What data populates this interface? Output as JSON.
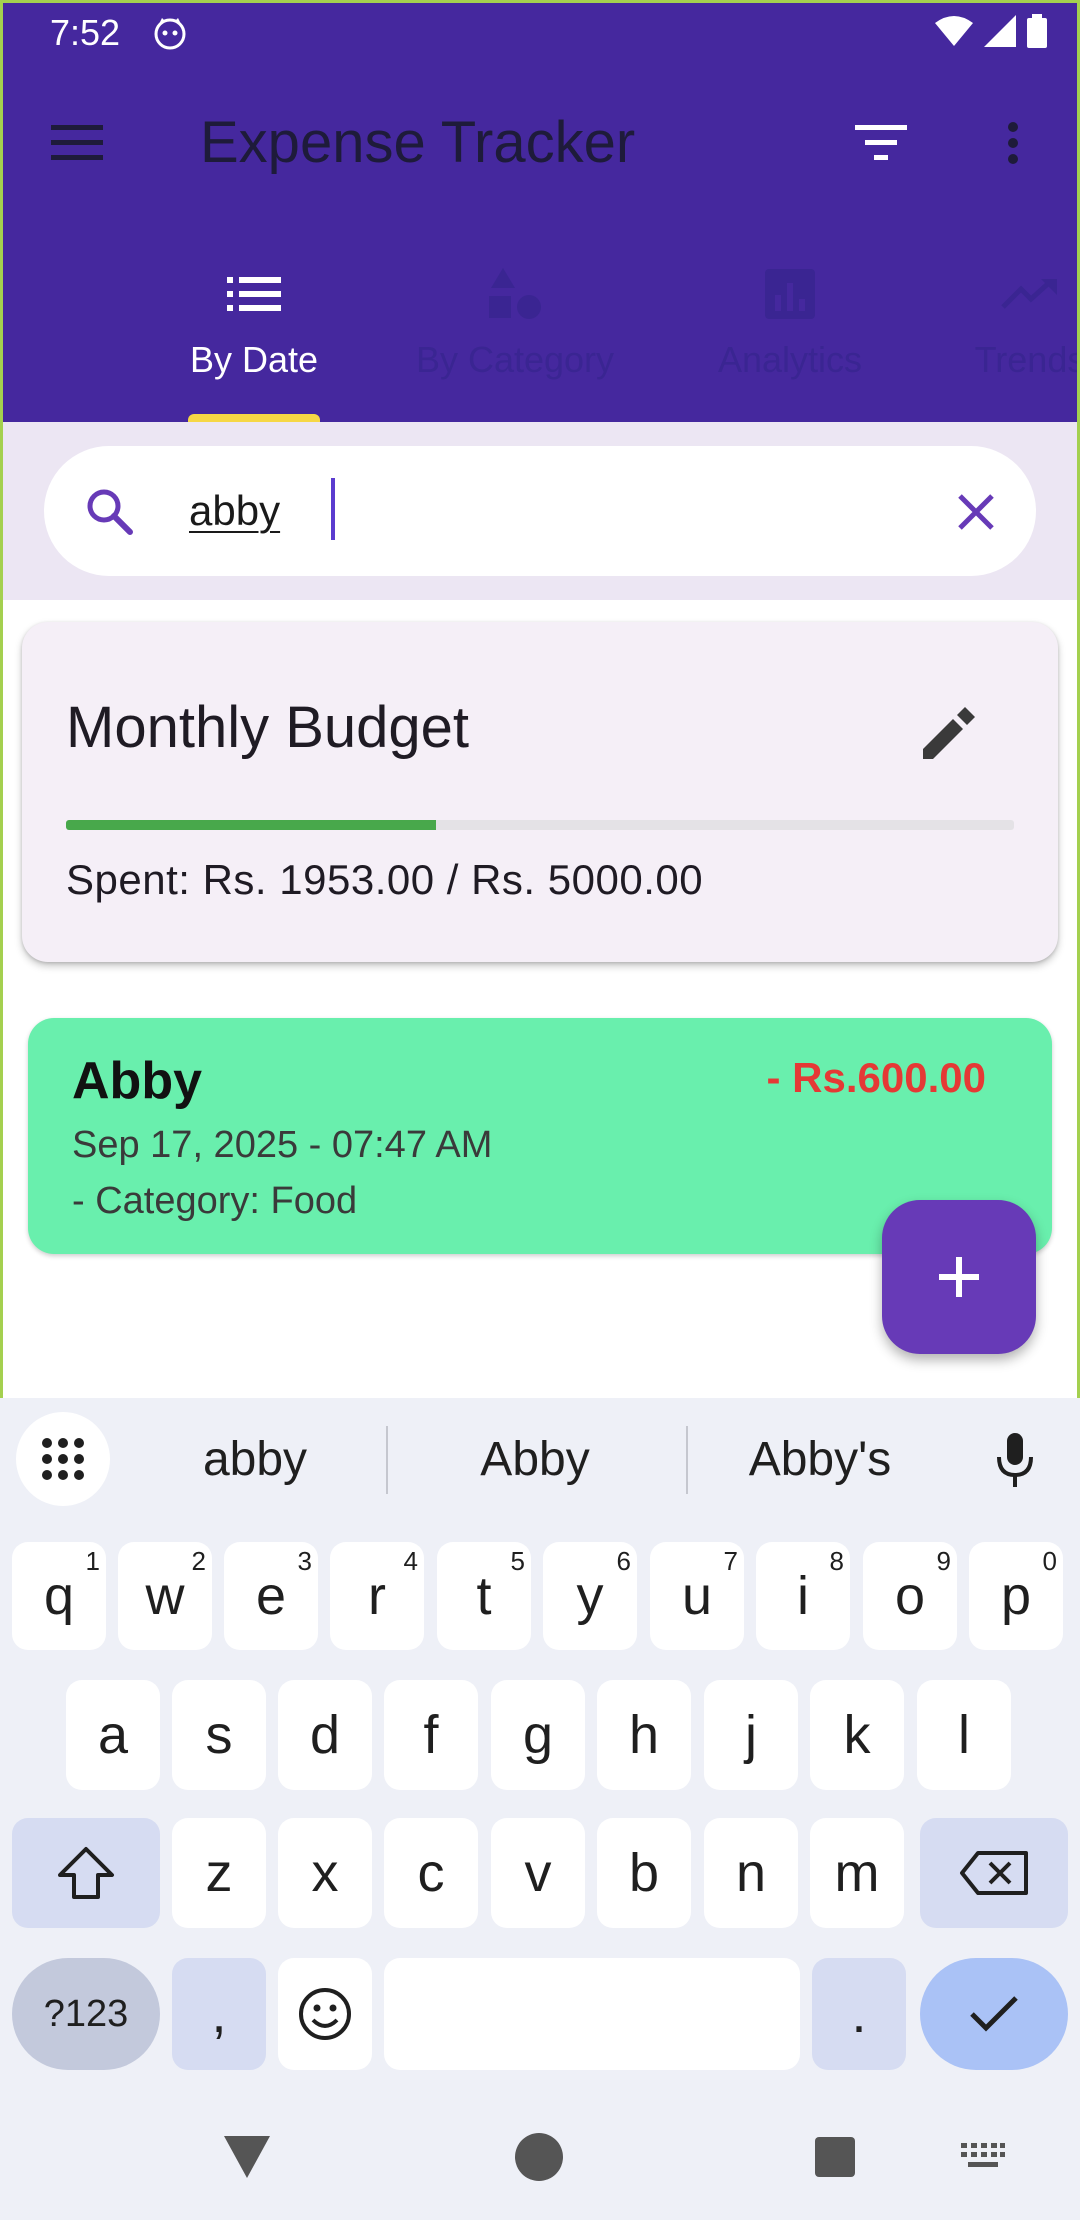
{
  "status_bar": {
    "time": "7:52"
  },
  "app_bar": {
    "title": "Expense Tracker"
  },
  "tabs": [
    {
      "label": "By Date",
      "active": true
    },
    {
      "label": "By Category",
      "active": false
    },
    {
      "label": "Analytics",
      "active": false
    },
    {
      "label": "Trends",
      "active": false
    }
  ],
  "search": {
    "value": "abby"
  },
  "budget": {
    "title": "Monthly Budget",
    "spent_text": "Spent: Rs. 1953.00 / Rs. 5000.00",
    "progress_fraction": 0.3906
  },
  "expenses": [
    {
      "name": "Abby",
      "amount": "- Rs.600.00",
      "date": "Sep 17, 2025 - 07:47 AM",
      "category": "- Category: Food"
    }
  ],
  "keyboard": {
    "suggestions": [
      "abby",
      "Abby",
      "Abby's"
    ],
    "row1": [
      {
        "k": "q",
        "h": "1"
      },
      {
        "k": "w",
        "h": "2"
      },
      {
        "k": "e",
        "h": "3"
      },
      {
        "k": "r",
        "h": "4"
      },
      {
        "k": "t",
        "h": "5"
      },
      {
        "k": "y",
        "h": "6"
      },
      {
        "k": "u",
        "h": "7"
      },
      {
        "k": "i",
        "h": "8"
      },
      {
        "k": "o",
        "h": "9"
      },
      {
        "k": "p",
        "h": "0"
      }
    ],
    "row2": [
      "a",
      "s",
      "d",
      "f",
      "g",
      "h",
      "j",
      "k",
      "l"
    ],
    "row3": [
      "z",
      "x",
      "c",
      "v",
      "b",
      "n",
      "m"
    ],
    "sym_label": "?123",
    "comma": ",",
    "period": "."
  },
  "colors": {
    "app_bar": "#45289e",
    "tab_indicator": "#f6d745",
    "expense_card": "#69efad",
    "expense_amount": "#e53935",
    "progress_fill": "#48a84b",
    "fab": "#673ab7"
  }
}
